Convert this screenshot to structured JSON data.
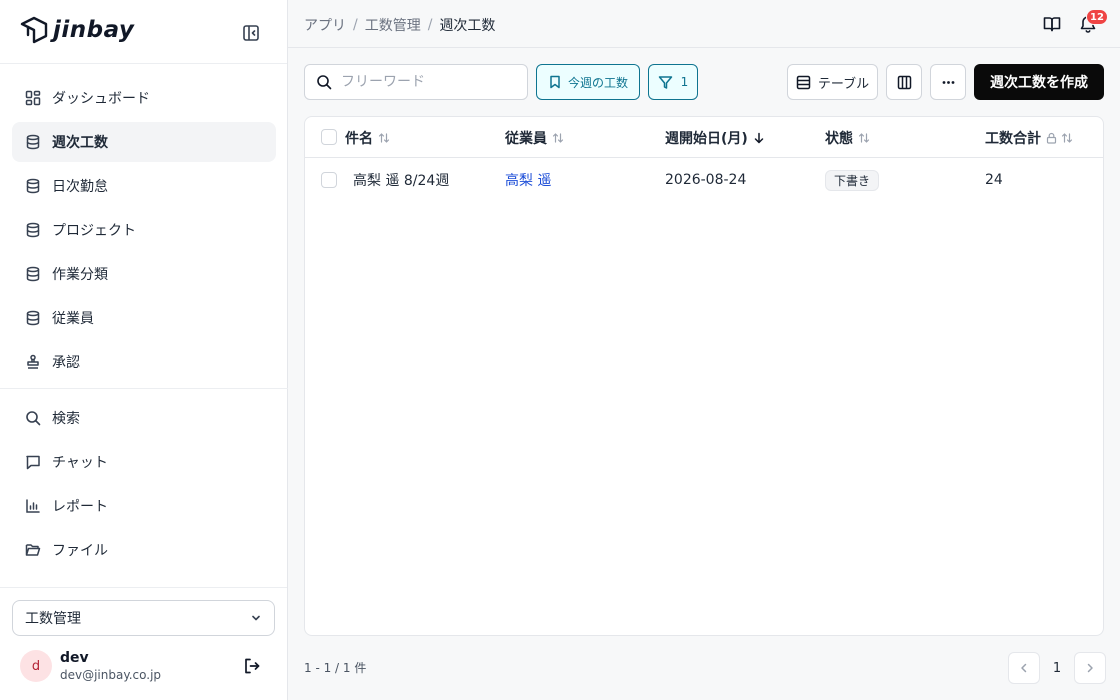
{
  "app": {
    "logo_text": "jinbay"
  },
  "sidebar": {
    "nav": [
      {
        "label": "ダッシュボード",
        "icon": "dashboard-icon",
        "active": false
      },
      {
        "label": "週次工数",
        "icon": "database-icon",
        "active": true
      },
      {
        "label": "日次勤怠",
        "icon": "database-icon",
        "active": false
      },
      {
        "label": "プロジェクト",
        "icon": "database-icon",
        "active": false
      },
      {
        "label": "作業分類",
        "icon": "database-icon",
        "active": false
      },
      {
        "label": "従業員",
        "icon": "database-icon",
        "active": false
      },
      {
        "label": "承認",
        "icon": "stamp-icon",
        "active": false
      }
    ],
    "tools": [
      {
        "label": "検索",
        "icon": "search-icon"
      },
      {
        "label": "チャット",
        "icon": "chat-icon"
      },
      {
        "label": "レポート",
        "icon": "bar-chart-icon"
      },
      {
        "label": "ファイル",
        "icon": "folder-icon"
      }
    ],
    "workspace": "工数管理",
    "user": {
      "initial": "d",
      "name": "dev",
      "email": "dev@jinbay.co.jp"
    }
  },
  "header": {
    "breadcrumb": [
      "アプリ",
      "工数管理",
      "週次工数"
    ],
    "notification_count": "12"
  },
  "toolbar": {
    "search_placeholder": "フリーワード",
    "saved_view_label": "今週の工数",
    "filter_count": "1",
    "view_label": "テーブル",
    "create_label": "週次工数を作成"
  },
  "table": {
    "columns": [
      "件名",
      "従業員",
      "週開始日(月)",
      "状態",
      "工数合計"
    ],
    "rows": [
      {
        "title": "高梨 遥 8/24週",
        "employee": "高梨 遥",
        "week_start": "2026-08-24",
        "status": "下書き",
        "total_hours": "24"
      }
    ]
  },
  "footer": {
    "count": "1 - 1 / 1 件",
    "page": "1"
  },
  "colors": {
    "accent": "#0e7490",
    "primary_button": "#0a0a0a",
    "link": "#1d4ed8",
    "badge": "#ef4444"
  }
}
